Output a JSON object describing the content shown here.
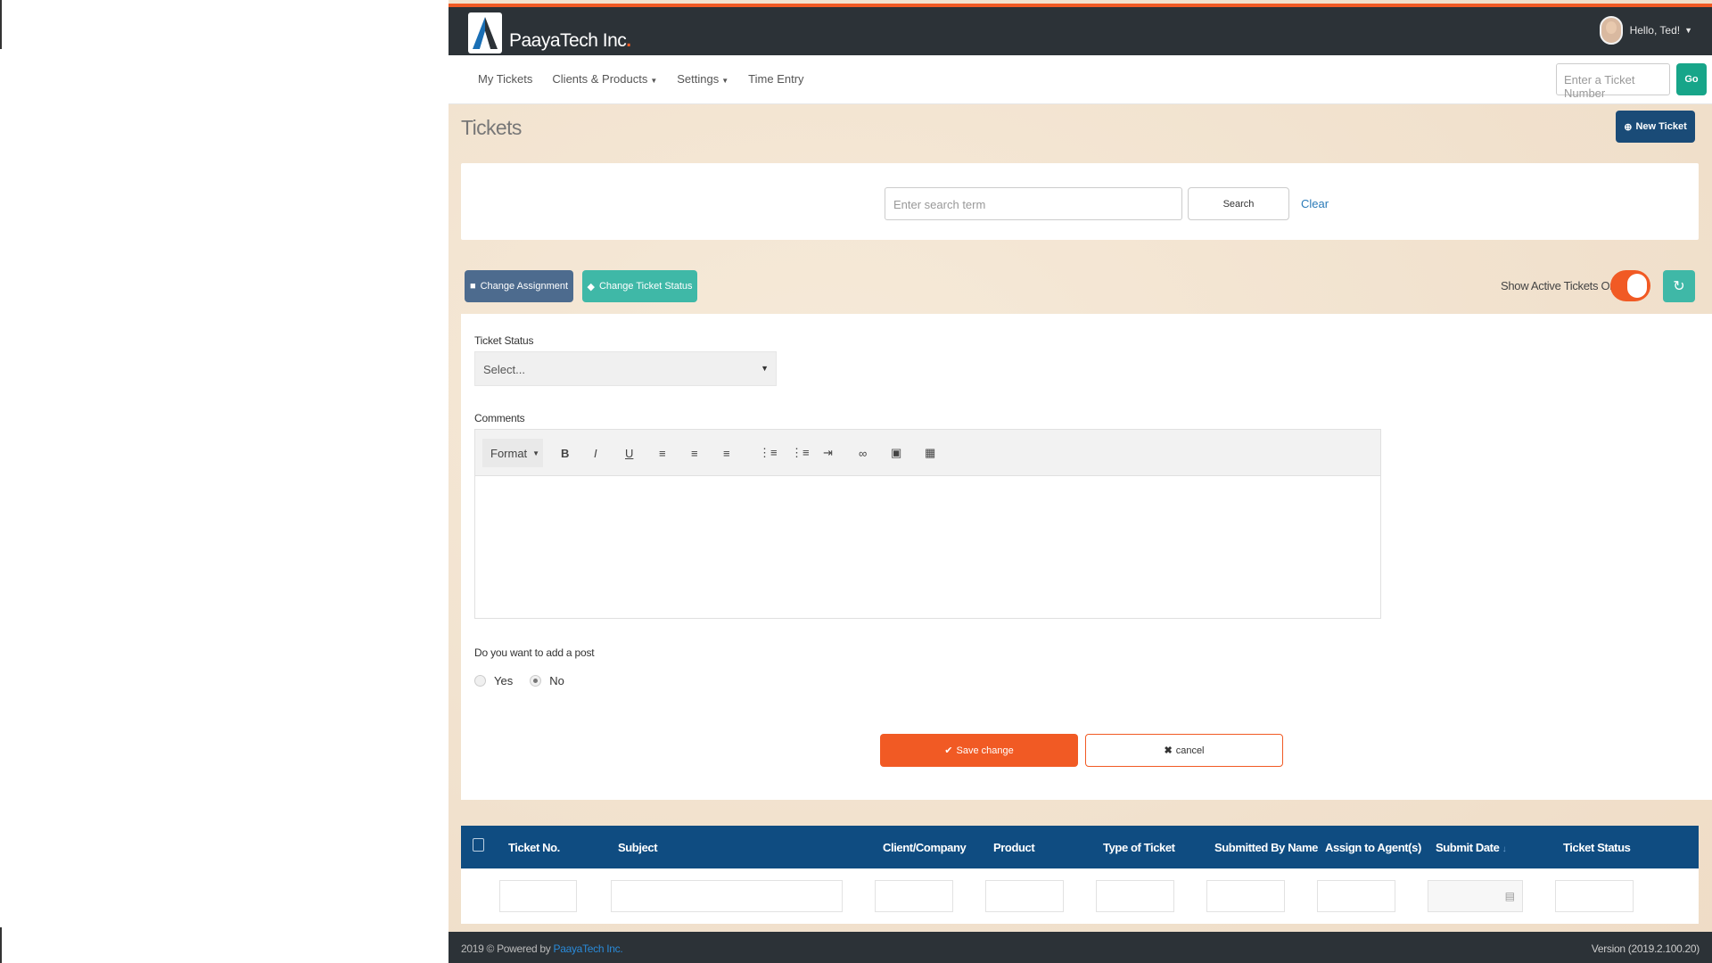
{
  "brand": {
    "name": "PaayaTech Inc",
    "dot": "."
  },
  "user": {
    "greeting": "Hello, Ted!"
  },
  "nav": {
    "items": [
      "My Tickets",
      "Clients & Products",
      "Settings",
      "Time Entry"
    ],
    "ticket_placeholder": "Enter a Ticket Number",
    "go_label": "Go"
  },
  "page": {
    "title": "Tickets",
    "new_ticket_label": "New Ticket"
  },
  "search": {
    "placeholder": "Enter search term",
    "button_label": "Search",
    "clear_label": "Clear"
  },
  "actions": {
    "change_assignment": "Change Assignment",
    "change_status": "Change Ticket Status",
    "active_only_label": "Show Active Tickets Only",
    "active_only_on": true
  },
  "form": {
    "status_label": "Ticket Status",
    "status_value": "Select...",
    "comments_label": "Comments",
    "format_label": "Format",
    "post_question": "Do you want to add a post",
    "yes_label": "Yes",
    "no_label": "No",
    "selected": "No",
    "save_label": "Save change",
    "cancel_label": "cancel"
  },
  "table": {
    "columns": [
      "Ticket No.",
      "Subject",
      "Client/Company",
      "Product",
      "Type of Ticket",
      "Submitted By Name",
      "Assign to Agent(s)",
      "Submit Date",
      "Ticket Status"
    ]
  },
  "footer": {
    "copyright": "2019 © Powered by ",
    "company_link": "PaayaTech Inc.",
    "version": "Version (2019.2.100.20)"
  },
  "colors": {
    "accent": "#f15a24",
    "teal": "#3fb8a7",
    "navy": "#0f4c81",
    "dark": "#2c3237"
  }
}
